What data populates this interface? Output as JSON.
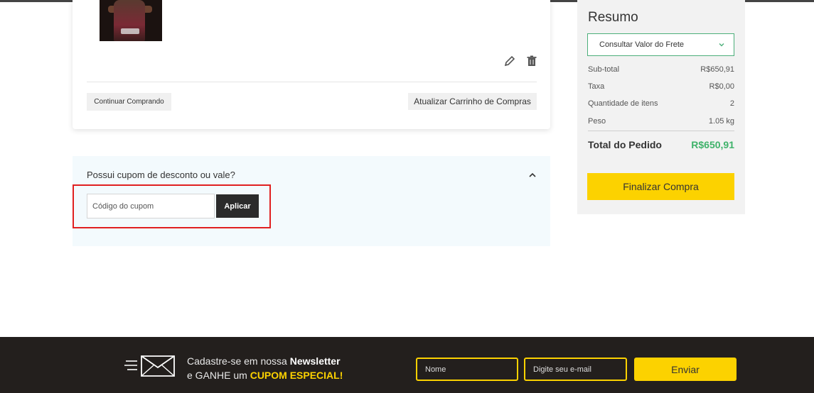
{
  "cart": {
    "continue_label": "Continuar Comprando",
    "update_label": "Atualizar Carrinho de Compras",
    "edit_icon": "pencil-icon",
    "delete_icon": "trash-icon"
  },
  "coupon": {
    "title": "Possui cupom de desconto ou vale?",
    "placeholder": "Código do cupom",
    "apply_label": "Aplicar"
  },
  "summary": {
    "title": "Resumo",
    "shipping_label": "Consultar Valor do Frete",
    "rows": [
      {
        "label": "Sub-total",
        "value": "R$650,91"
      },
      {
        "label": "Taxa",
        "value": "R$0,00"
      },
      {
        "label": "Quantidade de itens",
        "value": "2"
      },
      {
        "label": "Peso",
        "value": "1.05 kg"
      }
    ],
    "total_label": "Total do Pedido",
    "total_value": "R$650,91",
    "checkout_label": "Finalizar Compra",
    "total_color": "#3fb26a",
    "accent": "#fcd200"
  },
  "newsletter": {
    "line1_prefix": "Cadastre-se em nossa ",
    "line1_bold": "Newsletter",
    "line2_prefix": "e GANHE um ",
    "line2_highlight": "CUPOM ESPECIAL!",
    "name_placeholder": "Nome",
    "email_placeholder": "Digite seu e-mail",
    "send_label": "Enviar"
  }
}
